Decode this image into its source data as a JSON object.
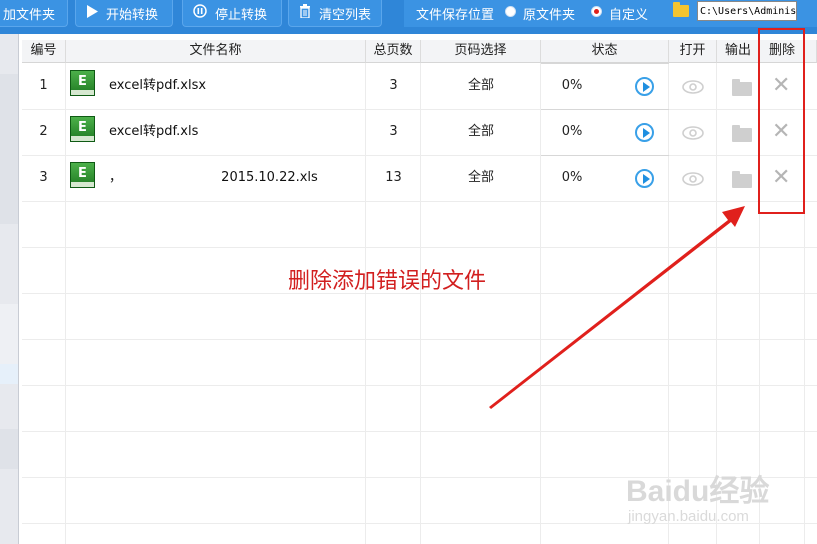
{
  "toolbar": {
    "add_folder": "加文件夹",
    "start_convert": "开始转换",
    "stop_convert": "停止转换",
    "clear_list": "清空列表",
    "save_location_label": "文件保存位置",
    "option_original": "原文件夹",
    "option_custom": "自定义",
    "selected_option": "自定义",
    "path_value": "C:\\Users\\Adminis"
  },
  "table": {
    "headers": [
      "编号",
      "文件名称",
      "总页数",
      "页码选择",
      "状态",
      "打开",
      "输出",
      "删除"
    ],
    "rows": [
      {
        "index": "1",
        "name": "excel转pdf.xlsx",
        "pages": "3",
        "range": "全部",
        "status": "0%"
      },
      {
        "index": "2",
        "name": "excel转pdf.xls",
        "pages": "3",
        "range": "全部",
        "status": "0%"
      },
      {
        "index": "3",
        "name": "，                        2015.10.22.xls",
        "pages": "13",
        "range": "全部",
        "status": "0%"
      }
    ],
    "file_icon_letter": "E"
  },
  "annotation": {
    "text": "删除添加错误的文件",
    "color": "#d21f1f"
  },
  "watermark": {
    "brand": "Baidu经验",
    "url": "jingyan.baidu.com"
  },
  "colors": {
    "toolbar": "#2f86d8",
    "accent_red": "#e0201c",
    "play_blue": "#1f8fe0"
  }
}
